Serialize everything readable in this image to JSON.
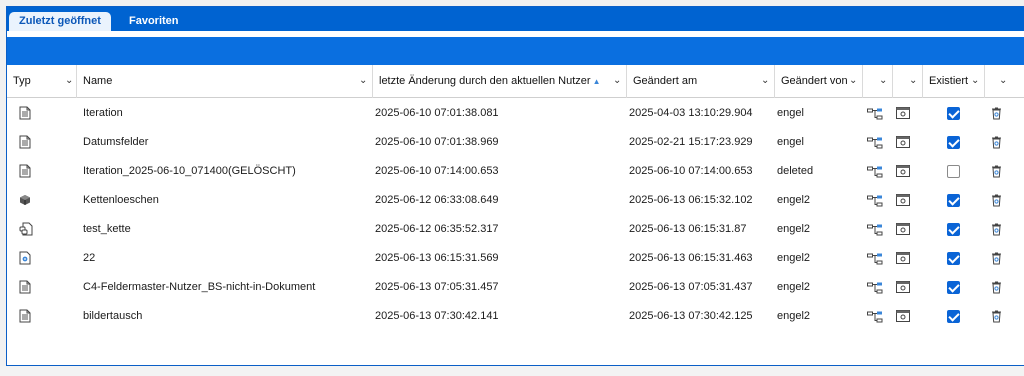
{
  "tabs": {
    "recent": "Zuletzt geöffnet",
    "favorites": "Favoriten"
  },
  "columns": {
    "type": "Typ",
    "name": "Name",
    "last_change_user": "letzte Änderung durch den aktuellen Nutzer",
    "changed_on": "Geändert am",
    "changed_by": "Geändert von",
    "exists": "Existiert"
  },
  "rows": [
    {
      "type_icon": "document-icon",
      "name": "Iteration",
      "last_change": "2025-06-10 07:01:38.081",
      "changed_on": "2025-04-03 13:10:29.904",
      "changed_by": "engel",
      "exists": true
    },
    {
      "type_icon": "document-icon",
      "name": "Datumsfelder",
      "last_change": "2025-06-10 07:01:38.969",
      "changed_on": "2025-02-21 15:17:23.929",
      "changed_by": "engel",
      "exists": true
    },
    {
      "type_icon": "document-icon",
      "name": "Iteration_2025-06-10_071400(GELÖSCHT)",
      "last_change": "2025-06-10 07:14:00.653",
      "changed_on": "2025-06-10 07:14:00.653",
      "changed_by": "deleted",
      "exists": false
    },
    {
      "type_icon": "cube-icon",
      "name": "Kettenloeschen",
      "last_change": "2025-06-12 06:33:08.649",
      "changed_on": "2025-06-13 06:15:32.102",
      "changed_by": "engel2",
      "exists": true
    },
    {
      "type_icon": "chain-document-icon",
      "name": "test_kette",
      "last_change": "2025-06-12 06:35:52.317",
      "changed_on": "2025-06-13 06:15:31.87",
      "changed_by": "engel2",
      "exists": true
    },
    {
      "type_icon": "gear-document-icon",
      "name": "22",
      "last_change": "2025-06-13 06:15:31.569",
      "changed_on": "2025-06-13 06:15:31.463",
      "changed_by": "engel2",
      "exists": true
    },
    {
      "type_icon": "document-icon",
      "name": "C4-Feldermaster-Nutzer_BS-nicht-in-Dokument",
      "last_change": "2025-06-13 07:05:31.457",
      "changed_on": "2025-06-13 07:05:31.437",
      "changed_by": "engel2",
      "exists": true
    },
    {
      "type_icon": "document-icon",
      "name": "bildertausch",
      "last_change": "2025-06-13 07:30:42.141",
      "changed_on": "2025-06-13 07:30:42.125",
      "changed_by": "engel2",
      "exists": true
    }
  ],
  "colors": {
    "tabbar": "#0063d1",
    "toolbar": "#0a6fe0",
    "checkbox": "#0a64d6"
  }
}
